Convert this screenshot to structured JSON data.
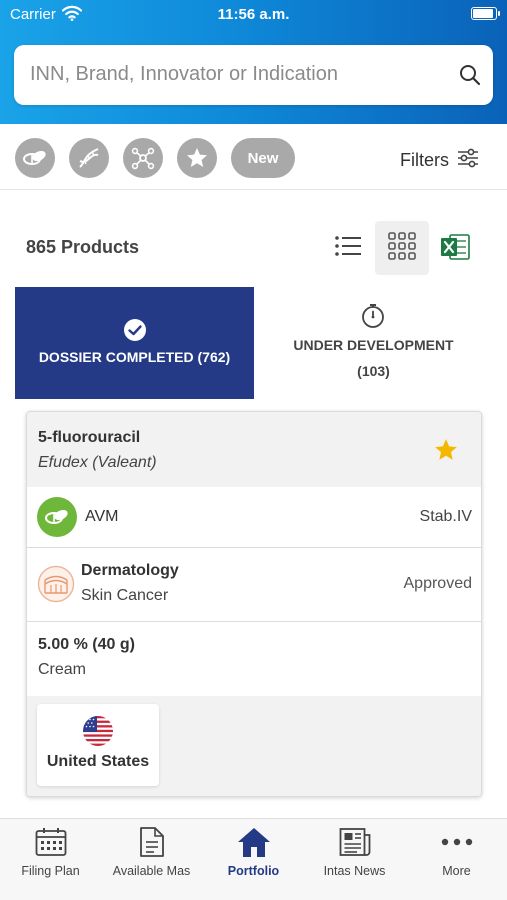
{
  "status_bar": {
    "carrier": "Carrier",
    "time": "11:56 a.m."
  },
  "search": {
    "placeholder": "INN, Brand, Innovator or Indication"
  },
  "quick_filters": {
    "icons": [
      "pill-icon",
      "dna-icon",
      "molecule-icon",
      "star-icon"
    ],
    "new_label": "New",
    "filters_label": "Filters"
  },
  "results": {
    "count_label": "865 Products"
  },
  "tabs": {
    "completed_label": "DOSSIER COMPLETED (762)",
    "development_label": "UNDER DEVELOPMENT",
    "development_count": "(103)"
  },
  "product": {
    "name": "5-fluorouracil",
    "brand": "Efudex (Valeant)",
    "favorite": true,
    "company": "AVM",
    "stability": "Stab.IV",
    "therapeutic_area": "Dermatology",
    "indication": "Skin Cancer",
    "approval_status": "Approved",
    "strength": "5.00 % (40 g)",
    "dosage_form": "Cream",
    "countries": [
      "United States"
    ]
  },
  "tabbar": {
    "items": [
      {
        "label": "Filing Plan",
        "icon": "calendar-icon"
      },
      {
        "label": "Available Mas",
        "icon": "document-icon"
      },
      {
        "label": "Portfolio",
        "icon": "home-icon"
      },
      {
        "label": "Intas News",
        "icon": "newspaper-icon"
      },
      {
        "label": "More",
        "icon": "more-dots-icon"
      }
    ],
    "active": "Portfolio"
  },
  "colors": {
    "header_gradient_start": "#1aa3e8",
    "header_gradient_end": "#0a62b8",
    "accent_navy": "#253a87",
    "favorite_star": "#f5b800",
    "company_badge": "#6eb73a",
    "excel_green": "#1d7a44"
  }
}
